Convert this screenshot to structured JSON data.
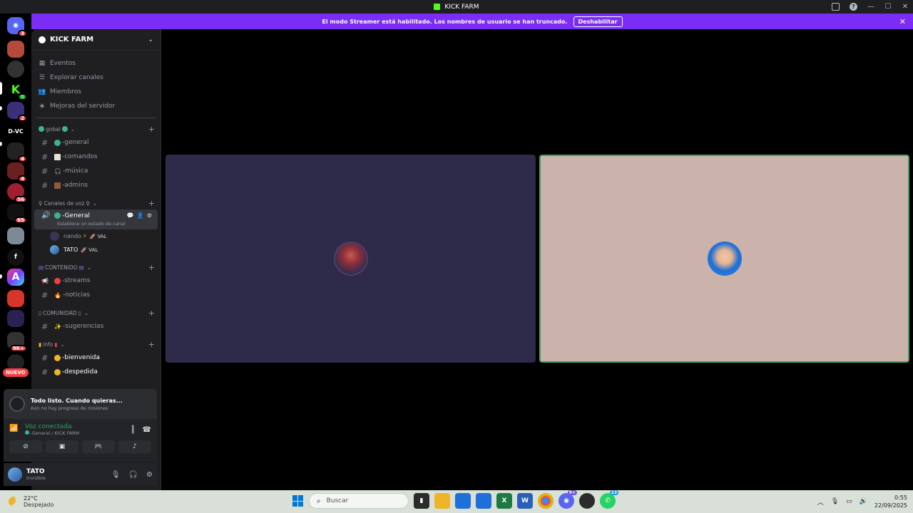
{
  "window": {
    "title": "KICK FARM"
  },
  "banner": {
    "message": "El modo Streamer está habilitado. Los nombres de usuario se han truncado.",
    "button": "Deshabilitar"
  },
  "server_rail": {
    "dvc_label": "D-VC",
    "f_label": "f",
    "nuevo": "NUEVO",
    "badges": {
      "discord": "3",
      "kick": "8",
      "s4": "2",
      "s7": "4",
      "s8": "4",
      "s9": "56",
      "s10": "65",
      "s18": "9K+"
    }
  },
  "sidebar": {
    "server_name": "KICK FARM",
    "nav": [
      "Eventos",
      "Explorar canales",
      "Miembros",
      "Mejoras del servidor"
    ],
    "categories": {
      "gobal": "gobal",
      "voz": "Canales de voz",
      "contenido": "CONTENIDO",
      "comunidad": "COMUNIDAD",
      "info": "info"
    },
    "channels": {
      "general": "-general",
      "comandos": "-comandos",
      "musica": "-música",
      "admins": "-admins",
      "voice_general": "-General",
      "voice_status": "Establece un estado de canal",
      "streams": "-streams",
      "noticias": "-noticias",
      "sugerencias": "-sugerencias",
      "bienvenida": "-bienvenida",
      "despedida": "-despedida"
    },
    "voice_users": [
      {
        "name": "nando",
        "tag": "VAL"
      },
      {
        "name": "TATO",
        "tag": "VAL"
      }
    ]
  },
  "quest": {
    "title": "Todo listo. Cuando quieras...",
    "subtitle": "Aún no hay progreso de misiones"
  },
  "voice": {
    "status": "Voz conectada",
    "location": "-General / KICK FARM"
  },
  "user": {
    "name": "TATO",
    "status": "Invisible"
  },
  "taskbar": {
    "temp": "22°C",
    "weather": "Despejado",
    "search_placeholder": "Buscar",
    "discord_badge": "9+",
    "whatsapp_badge": "23",
    "time": "0:55",
    "date": "22/09/2025"
  },
  "colors": {
    "banner": "#7b2cf5",
    "voice_connected": "#23a55a",
    "speaking_border": "#3ba55c",
    "kick_green": "#53fc18"
  }
}
